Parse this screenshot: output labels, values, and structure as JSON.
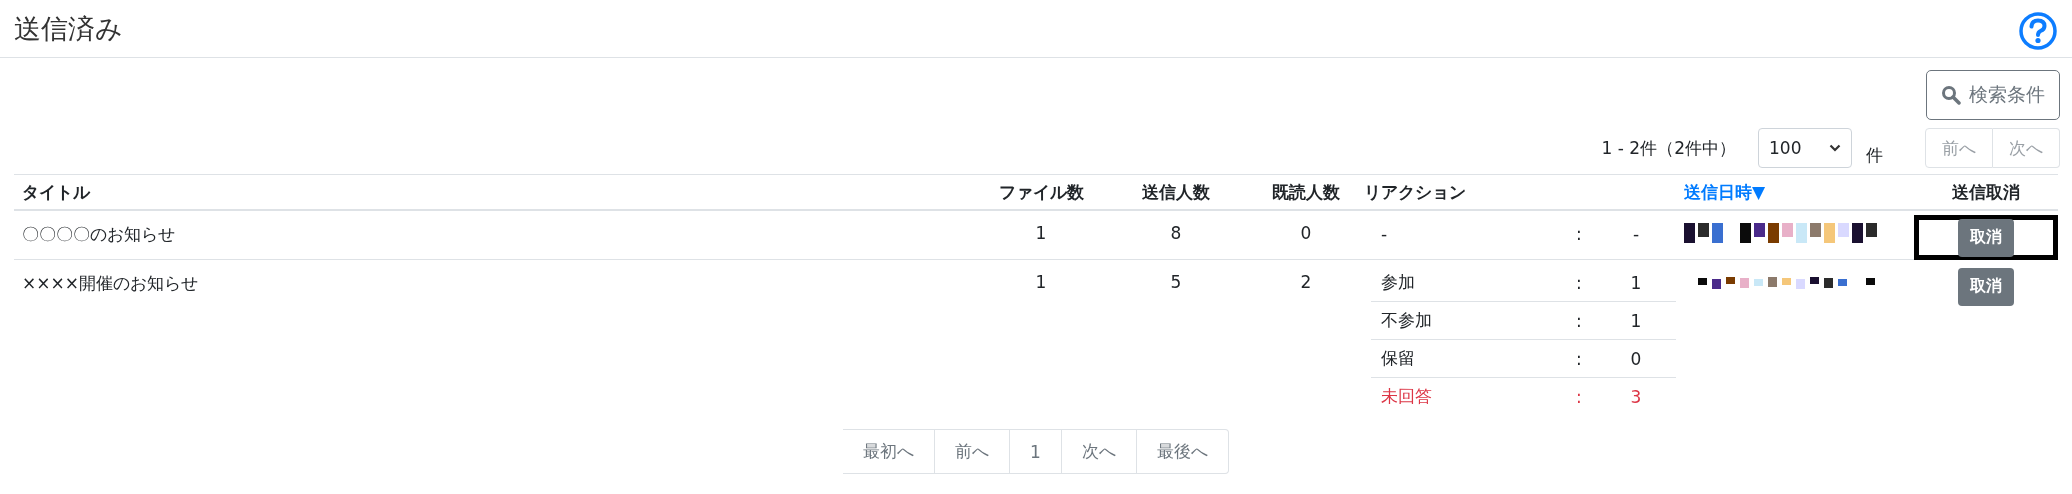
{
  "page": {
    "title": "送信済み"
  },
  "search_button": {
    "label": "検索条件"
  },
  "paging": {
    "summary": "1 - 2件（2件中）",
    "page_size": "100",
    "unit": "件",
    "buttons": [
      {
        "label": "前へ",
        "disabled": true
      },
      {
        "label": "次へ",
        "disabled": true
      }
    ]
  },
  "table": {
    "columns": [
      {
        "label": "タイトル",
        "kind": "text"
      },
      {
        "label": "ファイル数",
        "kind": "number"
      },
      {
        "label": "送信人数",
        "kind": "number"
      },
      {
        "label": "既読人数",
        "kind": "number"
      },
      {
        "label": "リアクション",
        "kind": "text"
      },
      {
        "label": "送信日時▼",
        "kind": "sort"
      },
      {
        "label": "送信取消",
        "kind": "number"
      }
    ],
    "rows": [
      {
        "title": "〇〇〇〇のお知らせ",
        "files": "1",
        "sent": "8",
        "read": "0",
        "reactions": [
          {
            "label": "-",
            "separator": ":",
            "value": "-",
            "kind": "normal"
          }
        ],
        "sent_at": {
          "kind": "picture"
        },
        "cancel": "取消",
        "highlighted": true
      },
      {
        "title": "××××開催のお知らせ",
        "files": "1",
        "sent": "5",
        "read": "2",
        "reactions": [
          {
            "label": "参加",
            "separator": ":",
            "value": "1",
            "kind": "count"
          },
          {
            "label": "不参加",
            "separator": ":",
            "value": "1",
            "kind": "count"
          },
          {
            "label": "保留",
            "separator": ":",
            "value": "0",
            "kind": "normal"
          },
          {
            "label": "未回答",
            "separator": ":",
            "value": "3",
            "kind": "unanswered"
          }
        ],
        "sent_at": {
          "kind": "picture"
        },
        "cancel": "取消",
        "highlighted": false
      }
    ]
  },
  "pager": [
    "最初へ",
    "前へ",
    "1",
    "次へ",
    "最後へ"
  ]
}
